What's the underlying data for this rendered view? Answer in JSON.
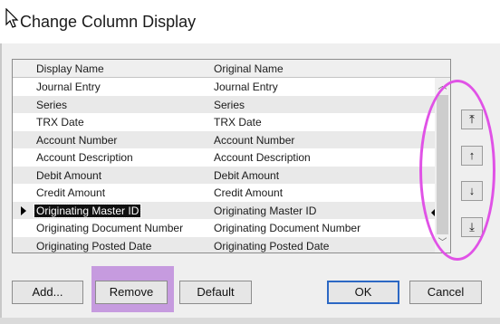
{
  "dialog": {
    "title": "Change Column Display"
  },
  "list": {
    "headers": {
      "display": "Display Name",
      "original": "Original Name"
    },
    "rows": [
      {
        "display": "Journal Entry",
        "original": "Journal Entry"
      },
      {
        "display": "Series",
        "original": "Series"
      },
      {
        "display": "TRX Date",
        "original": "TRX Date"
      },
      {
        "display": "Account Number",
        "original": "Account Number"
      },
      {
        "display": "Account Description",
        "original": "Account Description"
      },
      {
        "display": "Debit Amount",
        "original": "Debit Amount"
      },
      {
        "display": "Credit Amount",
        "original": "Credit Amount"
      },
      {
        "display": "Originating Master ID",
        "original": "Originating Master ID"
      },
      {
        "display": "Originating Document Number",
        "original": "Originating Document Number"
      },
      {
        "display": "Originating Posted Date",
        "original": "Originating Posted Date"
      }
    ],
    "selected_row_index": 7
  },
  "move_buttons": [
    {
      "name": "move-top-button",
      "glyph": "⤒",
      "icon": "move-to-top-icon"
    },
    {
      "name": "move-up-button",
      "glyph": "↑",
      "icon": "move-up-icon"
    },
    {
      "name": "move-down-button",
      "glyph": "↓",
      "icon": "move-down-icon"
    },
    {
      "name": "move-bottom-button",
      "glyph": "⤓",
      "icon": "move-to-bottom-icon"
    }
  ],
  "buttons": {
    "add": "Add...",
    "remove": "Remove",
    "default": "Default",
    "ok": "OK",
    "cancel": "Cancel"
  },
  "colors": {
    "highlight_rect": "#be8cdc",
    "annotation_ellipse": "#e052e6",
    "selection": "#101010",
    "ok_border": "#2c68c4"
  }
}
